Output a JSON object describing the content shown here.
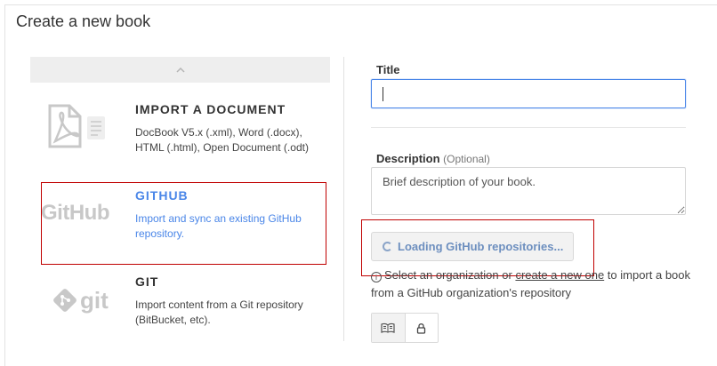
{
  "page_title": "Create a new book",
  "sources": [
    {
      "name": "IMPORT A DOCUMENT",
      "description": "DocBook V5.x (.xml), Word (.docx), HTML (.html), Open Document (.odt)",
      "icon": "pdf-document-icon"
    },
    {
      "name": "GITHUB",
      "description": "Import and sync an existing GitHub repository.",
      "icon": "github-logo",
      "logo_text": "GitHub",
      "selected": true
    },
    {
      "name": "GIT",
      "description": "Import content from a Git repository (BitBucket, etc).",
      "icon": "git-logo",
      "logo_text": "git"
    }
  ],
  "form": {
    "title_label": "Title",
    "title_value": "",
    "description_label": "Description",
    "description_optional": "(Optional)",
    "description_placeholder": "Brief description of your book.",
    "loading_button": "Loading GitHub repositories...",
    "help_prefix": "Select an organization or",
    "help_link": "create a new one",
    "help_suffix": "to import a book from a GitHub organization's repository"
  },
  "visibility": {
    "public_icon": "open-book-icon",
    "private_icon": "lock-icon"
  },
  "colors": {
    "accent": "#4a86e8",
    "highlight": "#c00000"
  }
}
